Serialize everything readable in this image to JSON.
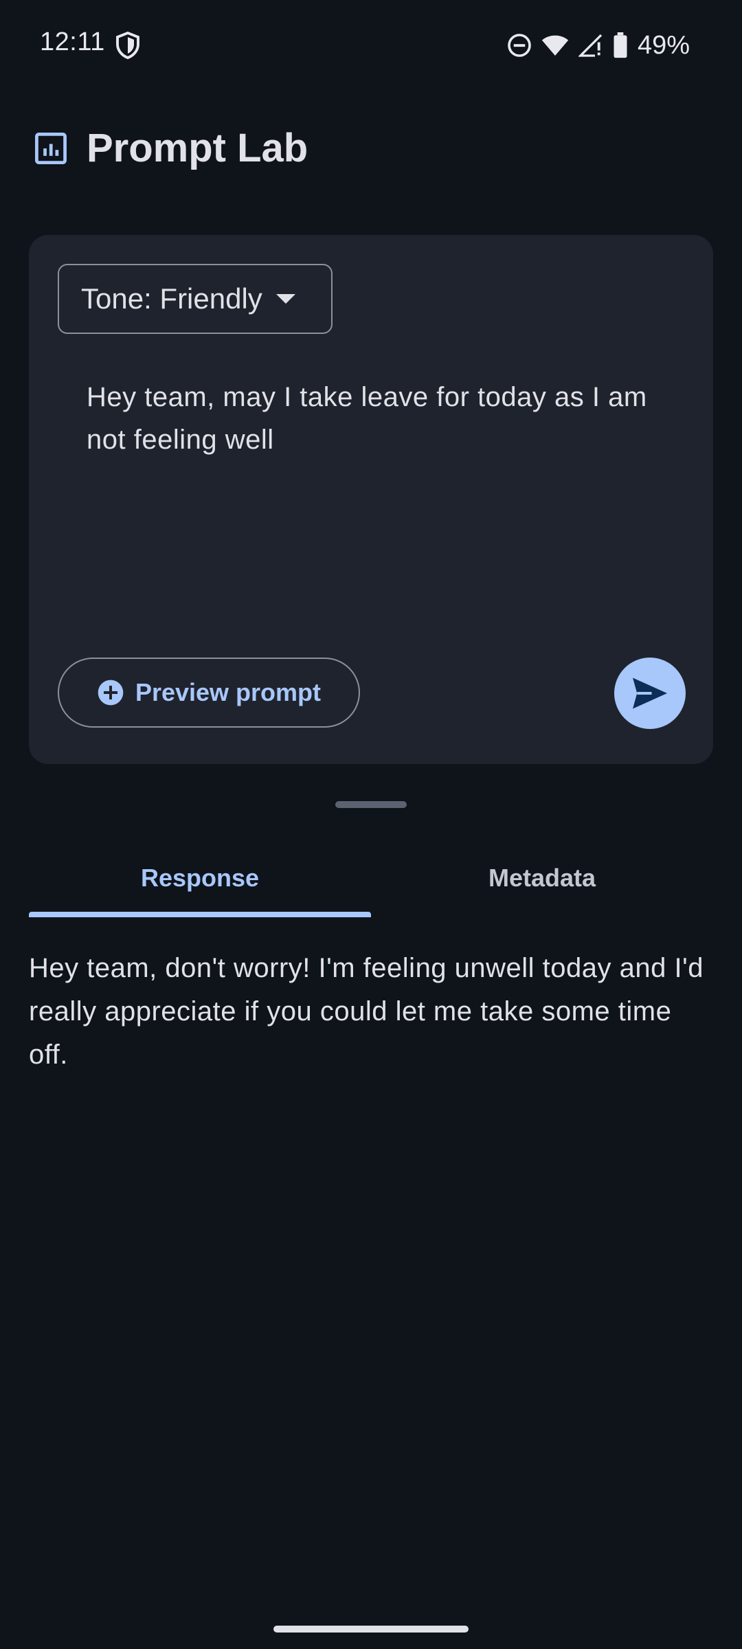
{
  "status_bar": {
    "time": "12:11",
    "battery": "49%",
    "icons": [
      "shield-icon",
      "do-not-disturb-icon",
      "wifi-icon",
      "signal-icon",
      "battery-icon"
    ]
  },
  "app_bar": {
    "title": "Prompt Lab",
    "icon": "dashboard-icon"
  },
  "prompt_card": {
    "tone_dropdown": {
      "label": "Tone: Friendly"
    },
    "prompt_text": "Hey team, may I take leave for today as I am not feeling well",
    "preview_button": "Preview prompt",
    "send_button_icon": "send-icon"
  },
  "tabs": [
    {
      "label": "Response",
      "selected": true
    },
    {
      "label": "Metadata",
      "selected": false
    }
  ],
  "response_text": "Hey team, don't worry! I'm feeling unwell today and I'd really appreciate if you could let me take some time off.",
  "colors": {
    "background": "#0f131a",
    "card": "#1f232d",
    "accent": "#a8c7fa",
    "text": "#e1e2e8"
  }
}
